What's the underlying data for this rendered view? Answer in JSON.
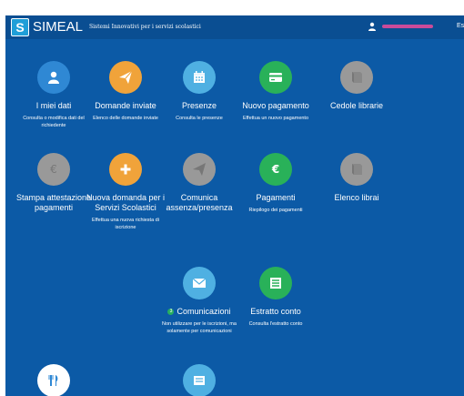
{
  "header": {
    "logo_letter": "S",
    "brand": "SIMEAL",
    "tagline": "Sistemi Innovativi per i servizi scolastici",
    "menu_label": "Es"
  },
  "colors": {
    "background": "#0c5aa6",
    "topbar": "#0a4e92",
    "blue": "#2f88d4",
    "orange": "#f0a33a",
    "light_blue": "#4fb0e2",
    "green": "#29b159",
    "grey": "#999999"
  },
  "tiles": [
    {
      "title": "I miei dati",
      "desc": "Consulta o modifica dati del richiedente",
      "icon": "user-icon"
    },
    {
      "title": "Domande inviate",
      "desc": "Elenco delle domande inviate",
      "icon": "paper-plane-icon"
    },
    {
      "title": "Presenze",
      "desc": "Consulta le presenze",
      "icon": "calendar-icon"
    },
    {
      "title": "Nuovo pagamento",
      "desc": "Effettua un nuovo pagamento",
      "icon": "credit-card-icon"
    },
    {
      "title": "Cedole librarie",
      "desc": "",
      "icon": "book-icon"
    },
    {
      "title": "Stampa attestazione pagamenti",
      "desc": "",
      "icon": "euro-icon"
    },
    {
      "title": "Nuova domanda per i Servizi Scolastici",
      "desc": "Effettua una nuova richiesta di iscrizione",
      "icon": "plus-icon"
    },
    {
      "title": "Comunica assenza/presenza",
      "desc": "",
      "icon": "paper-plane-icon"
    },
    {
      "title": "Pagamenti",
      "desc": "Riepilogo dei pagamenti",
      "icon": "euro-icon"
    },
    {
      "title": "Elenco librai",
      "desc": "",
      "icon": "book-icon"
    },
    {
      "title": "Comunicazioni",
      "badge": "3",
      "desc": "Non utilizzare per le iscrizioni, ma solamente per comunicazioni",
      "icon": "envelope-icon"
    },
    {
      "title": "Estratto conto",
      "desc": "Consulta l'estratto conto",
      "icon": "list-icon"
    },
    {
      "title": "",
      "desc": "",
      "icon": "cutlery-icon"
    },
    {
      "title": "",
      "desc": "",
      "icon": "menu-list-icon"
    }
  ]
}
